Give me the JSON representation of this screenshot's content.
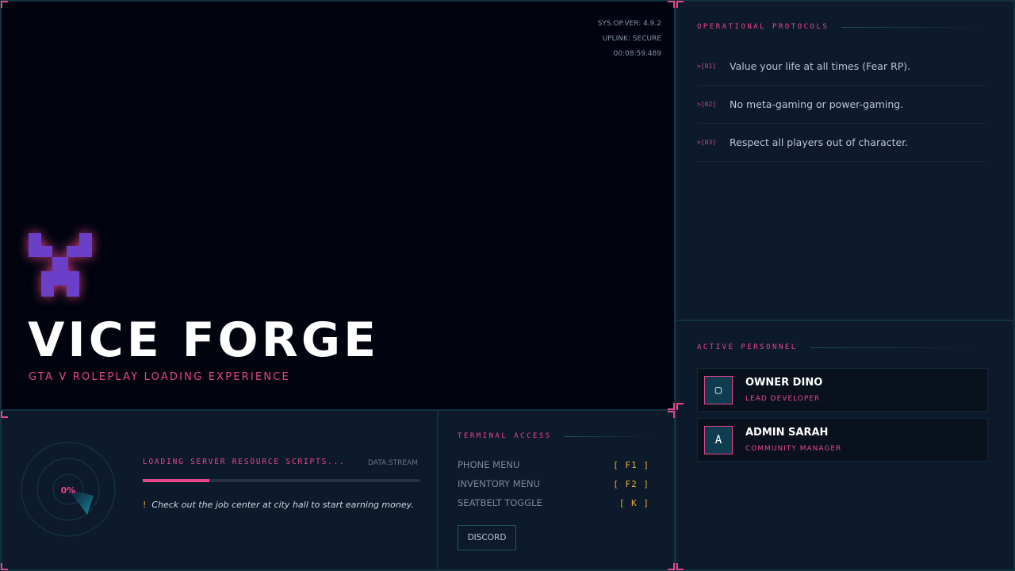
{
  "hero": {
    "sys_version": "SYS.OP.VER: 4.9.2",
    "uplink": "UPLINK: SECURE",
    "timer": "00:08:59.489",
    "logo_icon": "pixel-x-icon",
    "title": "VICE FORGE",
    "subtitle": "GTA V ROLEPLAY LOADING EXPERIENCE"
  },
  "protocols": {
    "heading": "OPERATIONAL PROTOCOLS",
    "items": [
      {
        "num": ">[01]",
        "text": "Value your life at all times (Fear RP)."
      },
      {
        "num": ">[02]",
        "text": "No meta-gaming or power-gaming."
      },
      {
        "num": ">[03]",
        "text": "Respect all players out of character."
      }
    ]
  },
  "personnel": {
    "heading": "ACTIVE PERSONNEL",
    "members": [
      {
        "glyph": "▢",
        "name": "OWNER DINO",
        "role": "LEAD DEVELOPER"
      },
      {
        "glyph": "A",
        "name": "ADMIN SARAH",
        "role": "COMMUNITY MANAGER"
      }
    ]
  },
  "loader": {
    "percent_label": "0%",
    "status": "LOADING SERVER RESOURCE SCRIPTS...",
    "stream_label": "DATA.STREAM",
    "progress_fraction": 0.24,
    "tip_icon": "!",
    "tip": "Check out the job center at city hall to start earning money."
  },
  "terminal": {
    "heading": "TERMINAL ACCESS",
    "keys": [
      {
        "label": "PHONE MENU",
        "key": "[ F1 ]"
      },
      {
        "label": "INVENTORY MENU",
        "key": "[ F2 ]"
      },
      {
        "label": "SEATBELT TOGGLE",
        "key": "[ K ]"
      }
    ],
    "discord_label": "DISCORD"
  },
  "colors": {
    "accent": "#e8468c",
    "key_gold": "#e9b034",
    "panel_bg": "#0d1a2b",
    "hero_bg": "#01030f",
    "logo_purple": "#6b3fc8"
  }
}
